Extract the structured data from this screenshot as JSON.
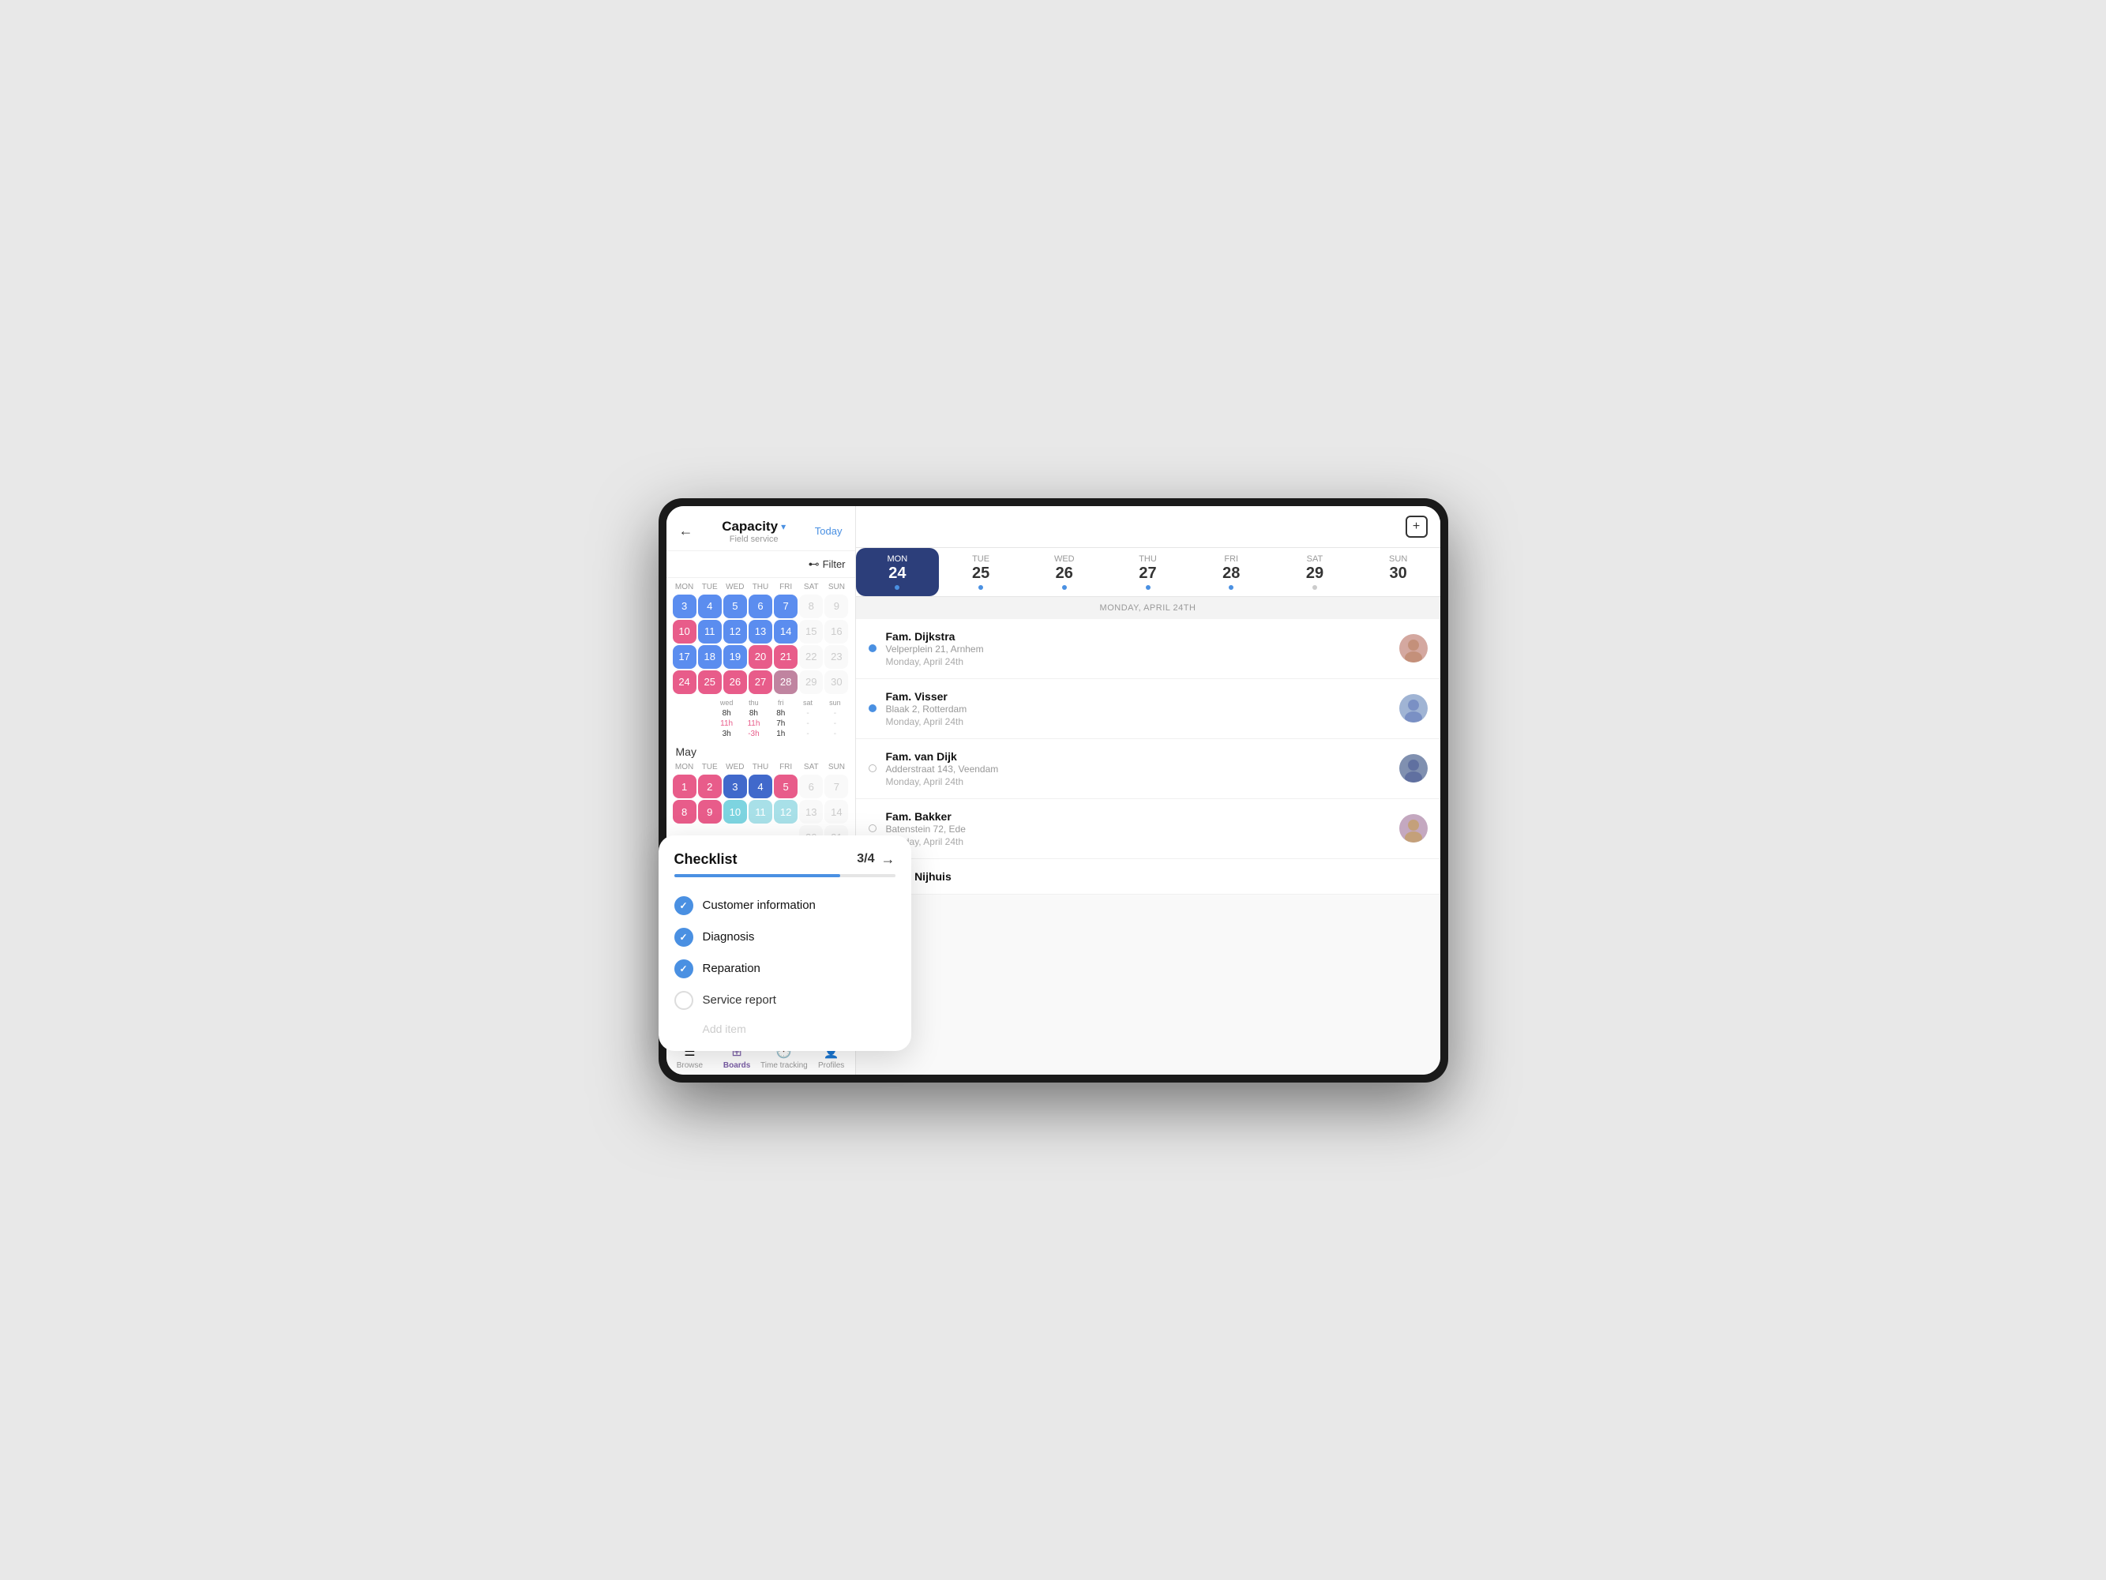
{
  "tablet": {
    "left_panel": {
      "back_label": "←",
      "title": "Capacity",
      "subtitle": "Field service",
      "dropdown_icon": "▾",
      "today_label": "Today",
      "filter_label": "Filter",
      "months": [
        {
          "name": "",
          "days_header": [
            "MON",
            "TUE",
            "WED",
            "THU",
            "FRI",
            "SAT",
            "SUN"
          ],
          "weeks": [
            [
              "",
              "",
              "",
              "",
              "",
              "8",
              "9"
            ],
            [
              "10",
              "11",
              "12",
              "13",
              "14",
              "15",
              "16"
            ],
            [
              "17",
              "18",
              "19",
              "20",
              "21",
              "22",
              "23"
            ],
            [
              "24",
              "25",
              "26",
              "27",
              "28",
              "29",
              "30"
            ]
          ],
          "day_types": [
            [
              "empty",
              "empty",
              "empty",
              "empty",
              "empty",
              "gray",
              "gray"
            ],
            [
              "pink",
              "blue",
              "blue",
              "blue",
              "blue",
              "gray",
              "gray"
            ],
            [
              "blue",
              "blue",
              "blue",
              "pink",
              "pink-light",
              "gray",
              "gray"
            ],
            [
              "pink",
              "pink",
              "pink",
              "pink",
              "pink-light",
              "gray",
              "gray"
            ]
          ]
        },
        {
          "name": "May",
          "days_header": [
            "MON",
            "TUE",
            "WED",
            "THU",
            "FRI",
            "SAT",
            "SUN"
          ],
          "weeks": [
            [
              "1",
              "2",
              "3",
              "4",
              "5",
              "6",
              "7"
            ],
            [
              "8",
              "9",
              "10",
              "11",
              "12",
              "13",
              "14"
            ],
            [
              "",
              "",
              "",
              "",
              "",
              "20",
              "21"
            ]
          ],
          "day_types": [
            [
              "pink",
              "pink",
              "blue-dark",
              "pink",
              "pink",
              "gray",
              "gray"
            ],
            [
              "pink",
              "pink",
              "teal",
              "teal",
              "teal",
              "gray",
              "gray"
            ],
            [
              "empty",
              "empty",
              "empty",
              "empty",
              "empty",
              "gray",
              "gray"
            ]
          ]
        }
      ],
      "capacity_rows": [
        {
          "label": "",
          "wed": "8h",
          "thu": "8h",
          "fri": "8h",
          "sat": "-",
          "sun": "-"
        },
        {
          "label": "",
          "wed": "11h",
          "thu": "11h",
          "fri": "7h",
          "sat": "-",
          "sun": "-",
          "wed_red": true,
          "thu_red": true
        },
        {
          "label": "",
          "wed": "3h",
          "thu": "-3h",
          "fri": "1h",
          "sat": "-",
          "sun": "-",
          "thu_red": true
        }
      ],
      "nav_items": [
        {
          "icon": "☰",
          "label": "Browse",
          "active": false
        },
        {
          "icon": "⊞",
          "label": "Boards",
          "active": true
        },
        {
          "icon": "🕐",
          "label": "Time tracking",
          "active": false
        },
        {
          "icon": "👤",
          "label": "Profiles",
          "active": false
        }
      ]
    },
    "right_panel": {
      "add_icon": "+",
      "week_days": [
        {
          "name": "MON",
          "num": "24",
          "active": true,
          "dot": "blue"
        },
        {
          "name": "TUE",
          "num": "25",
          "active": false,
          "dot": "blue"
        },
        {
          "name": "WED",
          "num": "26",
          "active": false,
          "dot": "blue"
        },
        {
          "name": "THU",
          "num": "27",
          "active": false,
          "dot": "blue"
        },
        {
          "name": "FRI",
          "num": "28",
          "active": false,
          "dot": "blue"
        },
        {
          "name": "SAT",
          "num": "29",
          "active": false,
          "dot": "gray"
        },
        {
          "name": "SUN",
          "num": "30",
          "active": false,
          "dot": "none"
        }
      ],
      "date_section": "MONDAY, APRIL 24TH",
      "appointments": [
        {
          "name": "Fam. Dijkstra",
          "address": "Velperplein 21, Arnhem",
          "date": "Monday, April 24th",
          "dot": "blue",
          "avatar_type": "female"
        },
        {
          "name": "Fam. Visser",
          "address": "Blaak 2, Rotterdam",
          "date": "Monday, April 24th",
          "dot": "blue",
          "avatar_type": "male"
        },
        {
          "name": "Fam. van Dijk",
          "address": "Adderstraat 143, Veendam",
          "date": "Monday, April 24th",
          "dot": "gray",
          "avatar_type": "male2"
        },
        {
          "name": "Fam. Bakker",
          "address": "Batenstein 72, Ede",
          "date": "Monday, April 24th",
          "dot": "gray",
          "avatar_type": "female2"
        },
        {
          "name": "Fam. Nijhuis",
          "address": "",
          "date": "",
          "dot": "gray",
          "avatar_type": ""
        }
      ]
    },
    "checklist": {
      "title": "Checklist",
      "progress_label": "3/4",
      "progress_pct": 75,
      "arrow": "→",
      "items": [
        {
          "label": "Customer information",
          "checked": true
        },
        {
          "label": "Diagnosis",
          "checked": true
        },
        {
          "label": "Reparation",
          "checked": true
        },
        {
          "label": "Service report",
          "checked": false
        }
      ],
      "add_item_label": "Add item"
    }
  }
}
